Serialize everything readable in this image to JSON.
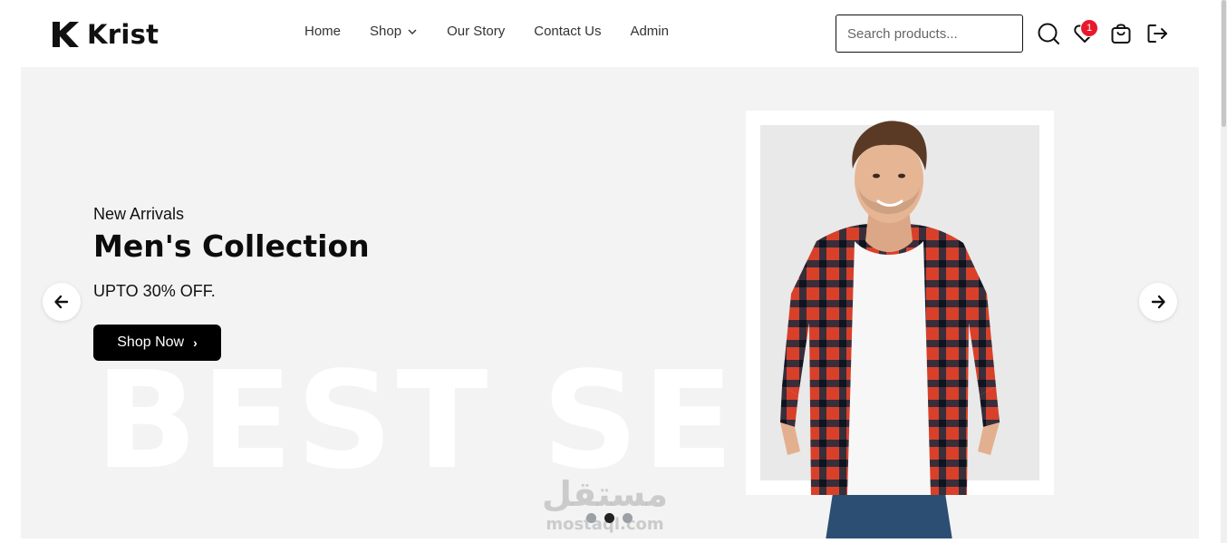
{
  "brand": {
    "name": "Krist"
  },
  "nav": {
    "items": [
      {
        "label": "Home"
      },
      {
        "label": "Shop",
        "has_dropdown": true
      },
      {
        "label": "Our Story"
      },
      {
        "label": "Contact Us"
      },
      {
        "label": "Admin"
      }
    ]
  },
  "search": {
    "placeholder": "Search products..."
  },
  "header_icons": {
    "search": "search-icon",
    "wishlist": "heart-icon",
    "wishlist_count": "1",
    "cart": "shopping-bag-icon",
    "logout": "logout-icon"
  },
  "hero": {
    "eyebrow": "New Arrivals",
    "title": "Men's Collection",
    "subtitle": "UPTO 30% OFF.",
    "cta_label": "Shop Now",
    "background_word": "BEST SELL",
    "slides_total": 3,
    "active_slide": 2
  },
  "watermark": {
    "arabic": "مستقل",
    "latin": "mostaql.com"
  },
  "colors": {
    "accent": "#000000",
    "badge": "#e8192c",
    "hero_bg": "#f3f3f3",
    "shirt_red": "#d8402a",
    "shirt_dark": "#1f2a3d"
  }
}
